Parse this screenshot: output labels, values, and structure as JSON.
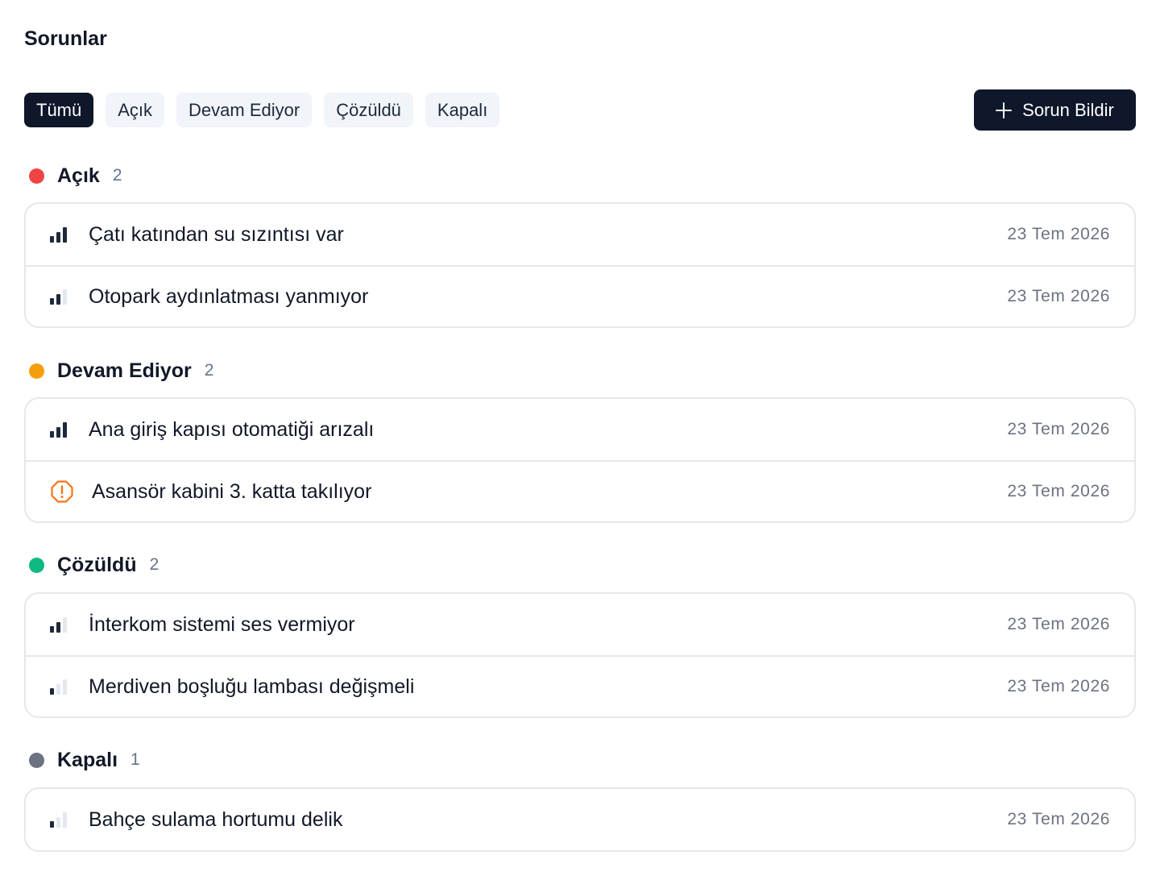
{
  "page": {
    "title": "Sorunlar"
  },
  "filters": [
    {
      "label": "Tümü",
      "active": true
    },
    {
      "label": "Açık",
      "active": false
    },
    {
      "label": "Devam Ediyor",
      "active": false
    },
    {
      "label": "Çözüldü",
      "active": false
    },
    {
      "label": "Kapalı",
      "active": false
    }
  ],
  "report_button": {
    "label": "Sorun Bildir",
    "icon": "plus-icon"
  },
  "groups": [
    {
      "name": "Açık",
      "count": "2",
      "color": "#ef4444",
      "items": [
        {
          "title": "Çatı katından su sızıntısı var",
          "date": "23 Tem 2026",
          "priority": 3
        },
        {
          "title": "Otopark aydınlatması yanmıyor",
          "date": "23 Tem 2026",
          "priority": 2
        }
      ]
    },
    {
      "name": "Devam Ediyor",
      "count": "2",
      "color": "#f59e0b",
      "items": [
        {
          "title": "Ana giriş kapısı otomatiği arızalı",
          "date": "23 Tem 2026",
          "priority": 3
        },
        {
          "title": "Asansör kabini 3. katta takılıyor",
          "date": "23 Tem 2026",
          "priority": "urgent"
        }
      ]
    },
    {
      "name": "Çözüldü",
      "count": "2",
      "color": "#10b981",
      "items": [
        {
          "title": "İnterkom sistemi ses vermiyor",
          "date": "23 Tem 2026",
          "priority": 2
        },
        {
          "title": "Merdiven boşluğu lambası değişmeli",
          "date": "23 Tem 2026",
          "priority": 1
        }
      ]
    },
    {
      "name": "Kapalı",
      "count": "1",
      "color": "#6b7280",
      "items": [
        {
          "title": "Bahçe sulama hortumu delik",
          "date": "23 Tem 2026",
          "priority": 1
        }
      ]
    }
  ],
  "colors": {
    "primary": "#0f172a",
    "chip_bg": "#f1f5f9",
    "urgent": "#f97316",
    "border": "#e5e7eb"
  }
}
